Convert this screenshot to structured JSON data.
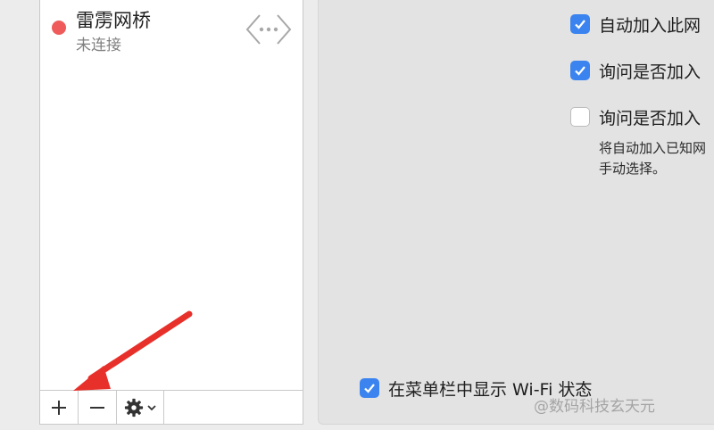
{
  "services": {
    "items": [
      {
        "name": "雷雳网桥",
        "status": "未连接",
        "status_color": "#ef5a5a",
        "icon": "thunderbolt-bridge-icon"
      }
    ]
  },
  "toolbar": {
    "add_label": "+",
    "remove_label": "−",
    "gear_icon": "gear-icon",
    "chevron_icon": "chevron-down-icon"
  },
  "options": {
    "auto_join": {
      "label": "自动加入此网",
      "checked": true
    },
    "ask_join_networks": {
      "label": "询问是否加入",
      "checked": true
    },
    "ask_join_hotspots": {
      "label": "询问是否加入",
      "checked": false
    },
    "hint_line1": "将自动加入已知网",
    "hint_line2": "手动选择。",
    "show_wifi_status": {
      "label": "在菜单栏中显示 Wi-Fi 状态",
      "checked": true
    }
  },
  "watermark": "@数码科技玄天元",
  "colors": {
    "accent": "#3b84f0",
    "annotation_arrow": "#e8302a"
  }
}
